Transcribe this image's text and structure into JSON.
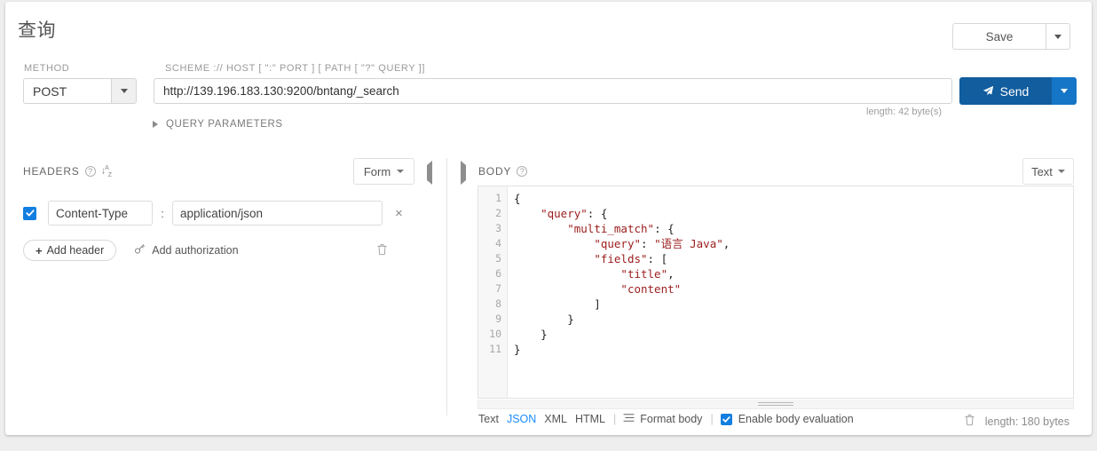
{
  "header": {
    "title": "查询",
    "save_label": "Save"
  },
  "request": {
    "method_label": "METHOD",
    "method_value": "POST",
    "url_label": "SCHEME :// HOST [ \":\" PORT ] [ PATH [ \"?\" QUERY ]]",
    "url_value": "http://139.196.183.130:9200/bntang/_search",
    "url_placeholder": "http://",
    "url_length": "length: 42 byte(s)",
    "send_label": "Send",
    "query_parameters_label": "QUERY PARAMETERS"
  },
  "headers_panel": {
    "section_label": "HEADERS",
    "help_icon": "question-circle-icon",
    "sort_icon": "sort-alpha-icon",
    "view_mode": "Form",
    "rows": [
      {
        "enabled": true,
        "key": "Content-Type",
        "value": "application/json",
        "remove": "×"
      }
    ],
    "add_header_label": "Add header",
    "add_authorization_label": "Add authorization",
    "trash_icon": "trash-icon"
  },
  "body_panel": {
    "section_label": "BODY",
    "help_icon": "question-circle-icon",
    "view_mode": "Text",
    "line_numbers": [
      1,
      2,
      3,
      4,
      5,
      6,
      7,
      8,
      9,
      10,
      11
    ],
    "code_lines": [
      "{",
      "    \"query\": {",
      "        \"multi_match\": {",
      "            \"query\": \"语言 Java\",",
      "            \"fields\": [",
      "                \"title\",",
      "                \"content\"",
      "            ]",
      "        }",
      "    }",
      "}"
    ],
    "format_options": [
      "Text",
      "JSON",
      "XML",
      "HTML"
    ],
    "format_active": "JSON",
    "format_body_label": "Format body",
    "enable_body_evaluation_label": "Enable body evaluation",
    "enable_body_evaluation_checked": true,
    "body_length": "length: 180 bytes",
    "trash_icon": "trash-icon"
  },
  "colors": {
    "accent_blue": "#127fe0",
    "send_blue": "#115d9e",
    "send_caret_blue": "#1576c8",
    "string_red": "#9b1c1c"
  }
}
